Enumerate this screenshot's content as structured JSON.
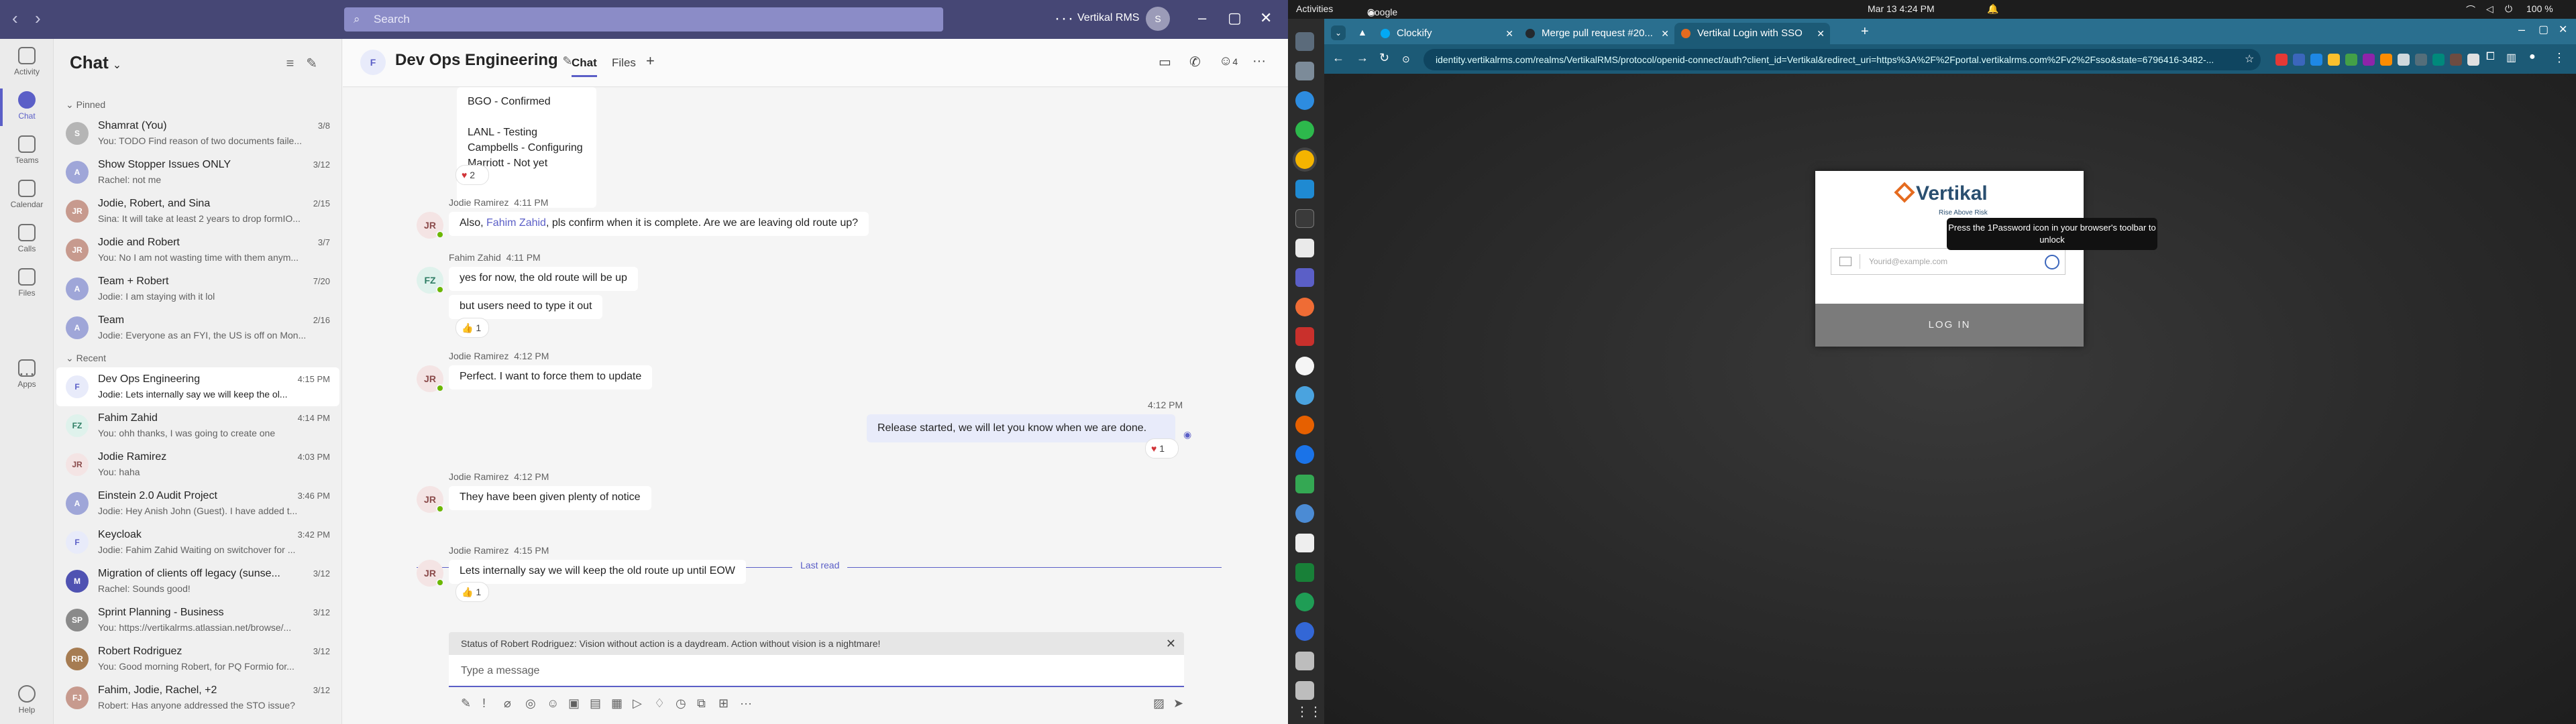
{
  "teams": {
    "search_placeholder": "Search",
    "org_name": "Vertikal RMS",
    "rail": [
      {
        "label": "Activity"
      },
      {
        "label": "Chat"
      },
      {
        "label": "Teams"
      },
      {
        "label": "Calendar"
      },
      {
        "label": "Calls"
      },
      {
        "label": "Files"
      },
      {
        "label": "Apps"
      },
      {
        "label": "Help"
      }
    ],
    "chat_header": "Chat",
    "pinned_label": "Pinned",
    "recent_label": "Recent",
    "pinned": [
      {
        "initials": "S",
        "name": "Shamrat (You)",
        "time": "3/8",
        "preview": "You: TODO Find reason of two documents faile..."
      },
      {
        "initials": "A",
        "name": "Show Stopper Issues ONLY",
        "time": "3/12",
        "preview": "Rachel: not me"
      },
      {
        "initials": "JR",
        "name": "Jodie, Robert, and Sina",
        "time": "2/15",
        "preview": "Sina: It will take at least 2 years to drop formIO..."
      },
      {
        "initials": "JR",
        "name": "Jodie and Robert",
        "time": "3/7",
        "preview": "You: No I am not wasting time with them anym..."
      },
      {
        "initials": "A",
        "name": "Team + Robert",
        "time": "7/20",
        "preview": "Jodie: I am staying with it lol"
      },
      {
        "initials": "A",
        "name": "Team",
        "time": "2/16",
        "preview": "Jodie: Everyone as an FYI, the US is off on Mon..."
      }
    ],
    "recent": [
      {
        "initials": "F",
        "name": "Dev Ops Engineering",
        "time": "4:15 PM",
        "preview": "Jodie: Lets internally say we will keep the ol..."
      },
      {
        "initials": "FZ",
        "name": "Fahim Zahid",
        "time": "4:14 PM",
        "preview": "You: ohh thanks, I was going to create one"
      },
      {
        "initials": "JR",
        "name": "Jodie Ramirez",
        "time": "4:03 PM",
        "preview": "You: haha"
      },
      {
        "initials": "A",
        "name": "Einstein 2.0 Audit Project",
        "time": "3:46 PM",
        "preview": "Jodie: Hey Anish John (Guest). I have added t..."
      },
      {
        "initials": "F",
        "name": "Keycloak",
        "time": "3:42 PM",
        "preview": "Jodie: Fahim Zahid Waiting on switchover for ..."
      },
      {
        "initials": "M",
        "name": "Migration of clients off legacy (sunse...",
        "time": "3/12",
        "preview": "Rachel: Sounds good!"
      },
      {
        "initials": "SP",
        "name": "Sprint Planning - Business",
        "time": "3/12",
        "preview": "You: https://vertikalrms.atlassian.net/browse/..."
      },
      {
        "initials": "RR",
        "name": "Robert Rodriguez",
        "time": "3/12",
        "preview": "You: Good morning Robert, for PQ Formio for..."
      },
      {
        "initials": "FJ",
        "name": "Fahim, Jodie, Rachel, +2",
        "time": "3/12",
        "preview": "Robert: Has anyone addressed the STO issue?"
      }
    ],
    "conversation": {
      "group_initial": "F",
      "title": "Dev Ops Engineering",
      "tab_chat": "Chat",
      "tab_files": "Files",
      "participants": "4",
      "top_lines": [
        "BGO - Confirmed",
        "LANL - Testing",
        "Campbells - Configuring",
        "Marriott - Not yet"
      ],
      "top_reaction": "2",
      "messages": [
        {
          "initials": "JR",
          "author": "Jodie Ramirez",
          "time": "4:11 PM",
          "pre": "Also, ",
          "mention": "Fahim Zahid",
          "post": ", pls confirm when it is complete.  Are we are leaving old route up?"
        },
        {
          "initials": "FZ",
          "author": "Fahim Zahid",
          "time": "4:11 PM",
          "line1": "yes for now, the old route will be up",
          "line2": "but users need to type it out",
          "reaction": "1"
        },
        {
          "initials": "JR",
          "author": "Jodie Ramirez",
          "time": "4:12 PM",
          "text": "Perfect.  I want to force them to update"
        },
        {
          "mine": true,
          "time": "4:12 PM",
          "text": "Release started, we will let you know when we are done.",
          "reaction": "1"
        },
        {
          "initials": "JR",
          "author": "Jodie Ramirez",
          "time": "4:12 PM",
          "text": "They have been given plenty of notice"
        },
        {
          "initials": "JR",
          "author": "Jodie Ramirez",
          "time": "4:15 PM",
          "text": "Lets internally say we will keep the old route up until EOW",
          "reaction": "1"
        }
      ],
      "last_read": "Last read",
      "status_text": "Status of Robert Rodriguez: Vision without action is a daydream. Action without vision is a nightmare!",
      "compose_placeholder": "Type a message"
    }
  },
  "desktop": {
    "activities": "Activities",
    "app_name": "Google Chrome",
    "clock": "Mar 13  4:24 PM",
    "battery": "100 %"
  },
  "chrome": {
    "tabs": [
      {
        "title": "Clockify"
      },
      {
        "title": "Merge pull request #20..."
      },
      {
        "title": "Vertikal Login with SSO"
      }
    ],
    "url": "identity.vertikalrms.com/realms/VertikalRMS/protocol/openid-connect/auth?client_id=Vertikal&redirect_uri=https%3A%2F%2Fportal.vertikalrms.com%2Fv2%2Fsso&state=6796416-3482-..."
  },
  "login": {
    "brand": "Vertikal",
    "tagline": "Rise Above Risk",
    "email_placeholder": "Yourid@example.com",
    "tooltip": "Press the 1Password icon in your browser's toolbar to unlock",
    "button": "LOG IN"
  },
  "colors": {
    "teams_purple": "#464775",
    "teams_accent": "#5b5fc7",
    "chrome_theme": "#1c5a76",
    "brand_orange": "#e56b1f",
    "brand_navy": "#2a4f70"
  }
}
